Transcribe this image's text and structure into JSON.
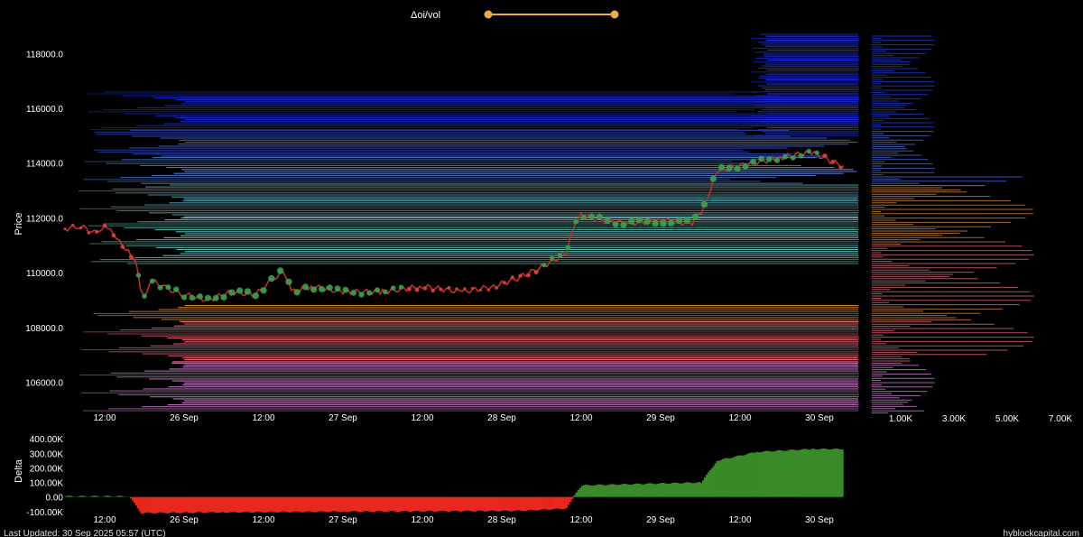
{
  "header": {
    "slider_label": "Δoi/vol",
    "slider_color": "#f0a848"
  },
  "footer": {
    "last_updated": "Last Updated: 30 Sep 2025 05:57 (UTC)",
    "brand": "hyblockcapital.com"
  },
  "chart_data": [
    {
      "type": "scatter",
      "ylabel": "Price",
      "ylim": [
        104800,
        118800
      ],
      "y_ticks": [
        "118000.0",
        "116000.0",
        "114000.0",
        "112000.0",
        "110000.0",
        "108000.0",
        "106000.0"
      ],
      "x_ticks": [
        "12:00",
        "26 Sep",
        "12:00",
        "27 Sep",
        "12:00",
        "28 Sep",
        "12:00",
        "29 Sep",
        "12:00",
        "30 Sep"
      ],
      "price_path": [
        [
          -0.5,
          111600
        ],
        [
          -0.3,
          111700
        ],
        [
          -0.1,
          111400
        ],
        [
          0,
          111800
        ],
        [
          0.15,
          111200
        ],
        [
          0.3,
          110800
        ],
        [
          0.4,
          110400
        ],
        [
          0.45,
          109300
        ],
        [
          0.5,
          109200
        ],
        [
          0.6,
          109700
        ],
        [
          0.8,
          109400
        ],
        [
          1.0,
          109200
        ],
        [
          1.3,
          109000
        ],
        [
          1.6,
          109300
        ],
        [
          1.9,
          109200
        ],
        [
          2.1,
          109700
        ],
        [
          2.25,
          110100
        ],
        [
          2.35,
          109300
        ],
        [
          2.6,
          109500
        ],
        [
          3.0,
          109300
        ],
        [
          3.5,
          109300
        ],
        [
          4.0,
          109500
        ],
        [
          4.5,
          109300
        ],
        [
          4.9,
          109500
        ],
        [
          5.2,
          109800
        ],
        [
          5.5,
          110200
        ],
        [
          5.8,
          110700
        ],
        [
          5.9,
          111600
        ],
        [
          6.0,
          112100
        ],
        [
          6.3,
          111900
        ],
        [
          6.6,
          111800
        ],
        [
          7.0,
          111900
        ],
        [
          7.4,
          111800
        ],
        [
          7.55,
          112400
        ],
        [
          7.7,
          113700
        ],
        [
          8.0,
          113900
        ],
        [
          8.5,
          114200
        ],
        [
          8.9,
          114400
        ],
        [
          9.2,
          114000
        ],
        [
          9.3,
          113900
        ]
      ],
      "liquidation_bands": [
        {
          "from": 115200,
          "to": 116600,
          "color": "#1a2ee0"
        },
        {
          "from": 114200,
          "to": 115200,
          "color": "#3a60e8"
        },
        {
          "from": 113200,
          "to": 114200,
          "color": "#5a88e0"
        },
        {
          "from": 112000,
          "to": 113200,
          "color": "#5fa8b8"
        },
        {
          "from": 110300,
          "to": 112000,
          "color": "#6ac8c4"
        },
        {
          "from": 108200,
          "to": 108800,
          "color": "#e68a3c"
        },
        {
          "from": 106700,
          "to": 108200,
          "color": "#f06a80"
        },
        {
          "from": 104900,
          "to": 106700,
          "color": "#d888d8"
        }
      ]
    },
    {
      "type": "bar",
      "x_ticks": [
        "1.00K",
        "3.00K",
        "5.00K",
        "7.00K"
      ]
    },
    {
      "type": "area",
      "ylabel": "Delta",
      "ylim": [
        -120000,
        420000
      ],
      "y_ticks": [
        "400.00K",
        "300.00K",
        "200.00K",
        "100.00K",
        "0.00",
        "-100.00K"
      ],
      "x_ticks": [
        "12:00",
        "26 Sep",
        "12:00",
        "27 Sep",
        "12:00",
        "28 Sep",
        "12:00",
        "29 Sep",
        "12:00",
        "30 Sep"
      ],
      "positive_color": "#3a8a2a",
      "negative_color": "#e8281e",
      "steps": [
        [
          -0.5,
          5000
        ],
        [
          0.3,
          5000
        ],
        [
          0.45,
          -110000
        ],
        [
          1.5,
          -105000
        ],
        [
          3.0,
          -100000
        ],
        [
          5.2,
          -95000
        ],
        [
          5.8,
          -80000
        ],
        [
          5.9,
          10000
        ],
        [
          6.0,
          80000
        ],
        [
          7.5,
          100000
        ],
        [
          7.7,
          250000
        ],
        [
          8.2,
          310000
        ],
        [
          8.9,
          330000
        ],
        [
          9.3,
          330000
        ]
      ]
    }
  ]
}
